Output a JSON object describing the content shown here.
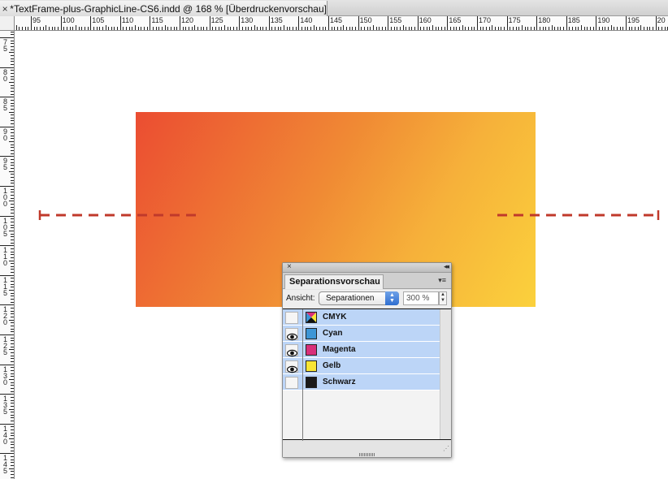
{
  "document_tab": {
    "title": "*TextFrame-plus-GraphicLine-CS6.indd @ 168 % [Überdruckenvorschau]",
    "close_glyph": "×"
  },
  "ruler_h": {
    "labels": [
      "95",
      "100",
      "105",
      "110",
      "115",
      "120",
      "125",
      "130",
      "135",
      "140",
      "145",
      "150",
      "155",
      "160",
      "165",
      "170",
      "175",
      "180",
      "185",
      "190",
      "195",
      "20"
    ]
  },
  "ruler_v": {
    "labels": [
      "7 5",
      "8 0",
      "8 5",
      "9 0",
      "9 5",
      "1 0 0",
      "1 0 5",
      "1 1 0",
      "1 1 5",
      "1 2 0",
      "1 2 5",
      "1 3 0",
      "1 3 5",
      "1 4 0",
      "1 4 5"
    ]
  },
  "canvas": {
    "gradient_colors": [
      "#eb4d32",
      "#f08a34",
      "#f6b13a",
      "#fbd13c"
    ],
    "graphic_line_color": "#c0392b"
  },
  "panel": {
    "close_glyph": "×",
    "collapse_glyph": "◂◂",
    "menu_glyph": "▾≡",
    "tab_label": "Separationsvorschau",
    "view_label": "Ansicht:",
    "view_value": "Separationen",
    "zoom_value": "300 %",
    "separations": [
      {
        "name": "CMYK",
        "visible": false,
        "color": "cmyk"
      },
      {
        "name": "Cyan",
        "visible": true,
        "color": "#3d95d6"
      },
      {
        "name": "Magenta",
        "visible": true,
        "color": "#d8307a"
      },
      {
        "name": "Gelb",
        "visible": true,
        "color": "#f8e535"
      },
      {
        "name": "Schwarz",
        "visible": false,
        "color": "#1a1a1a"
      }
    ]
  }
}
